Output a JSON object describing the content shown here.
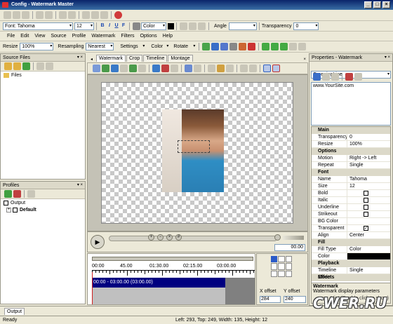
{
  "window": {
    "title": "Config - Watermark Master"
  },
  "toolbar": {
    "font_label": "Font",
    "font_value": "Tahoma",
    "size_value": "12",
    "bold": "B",
    "italic": "I",
    "underline": "U",
    "strike": "F",
    "color_label": "Color",
    "angle_label": "Angle",
    "transparency_label": "Transparency",
    "transparency_value": "0"
  },
  "menu": [
    "File",
    "Edit",
    "View",
    "Source",
    "Profile",
    "Watermark",
    "Filters",
    "Options",
    "Help"
  ],
  "toolbar2": {
    "resize_label": "Resize",
    "resize_value": "100%",
    "resampling_label": "Resampling",
    "resampling_value": "Nearest",
    "settings_label": "Settings",
    "color_label": "Color",
    "rotate_label": "Rotate"
  },
  "source_files": {
    "title": "Source Files",
    "root": "Files"
  },
  "profiles": {
    "title": "Profiles",
    "root": "Output",
    "child": "Default"
  },
  "tabs": [
    "Watermark",
    "Crop",
    "Timeline",
    "Montage"
  ],
  "player": {
    "time": "00.00"
  },
  "timeline": {
    "ruler": [
      "00:00",
      "45.00",
      "01:30.00",
      "02:15.00",
      "03:00.00"
    ],
    "clip": "00:00 - 03:00.00 (03:00.00)",
    "x_offset_label": "X offset",
    "y_offset_label": "Y offset",
    "x_offset": "284",
    "y_offset": "240"
  },
  "properties": {
    "title": "Properties - Watermark",
    "selector": "CreepingLine",
    "text": "www.YourSite.com",
    "sections": [
      {
        "name": "Main",
        "rows": [
          [
            "Transparency",
            "0"
          ],
          [
            "Resize",
            "100%"
          ]
        ]
      },
      {
        "name": "Options",
        "rows": [
          [
            "Motion",
            "Right -> Left"
          ],
          [
            "Repeat",
            "Single"
          ]
        ]
      },
      {
        "name": "Font",
        "rows": [
          [
            "Name",
            "Tahoma"
          ],
          [
            "Size",
            "12"
          ],
          [
            "Bold",
            ""
          ],
          [
            "Italic",
            ""
          ],
          [
            "Underline",
            ""
          ],
          [
            "Strikeout",
            ""
          ],
          [
            "BG Color",
            ""
          ],
          [
            "Transparent",
            ""
          ],
          [
            "Align",
            "Center"
          ]
        ]
      },
      {
        "name": "Fill",
        "rows": [
          [
            "Fill Type",
            "Color"
          ],
          [
            "Color",
            ""
          ]
        ]
      },
      {
        "name": "Playback",
        "rows": [
          [
            "Timeline Mode",
            "Single"
          ]
        ]
      },
      {
        "name": "Effects",
        "rows": []
      }
    ],
    "help_title": "Watermark",
    "help_text": "Watermark display parameters",
    "help_hint": "Hint (Double click to show)"
  },
  "output_tab": "Output",
  "status": {
    "left": "Ready",
    "info": "Left: 293, Top: 249, Width: 135, Height: 12"
  },
  "watermark_logo": "CWER.RU",
  "colors": {
    "fill_color": "#000000",
    "accent": "#0a246a",
    "clip": "#000080"
  }
}
